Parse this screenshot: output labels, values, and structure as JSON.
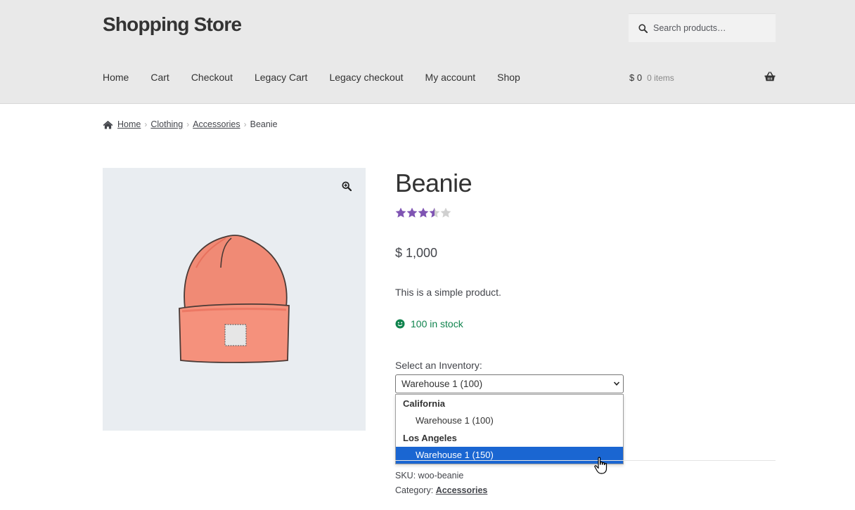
{
  "header": {
    "site_title": "Shopping Store",
    "search_placeholder": "Search products…",
    "nav": [
      "Home",
      "Cart",
      "Checkout",
      "Legacy Cart",
      "Legacy checkout",
      "My account",
      "Shop"
    ],
    "cart_total": "$ 0",
    "cart_items": "0 items"
  },
  "breadcrumb": [
    "Home",
    "Clothing",
    "Accessories",
    "Beanie"
  ],
  "product": {
    "title": "Beanie",
    "rating": 3.5,
    "rating_max": 5,
    "price": "$ 1,000",
    "short_description": "This is a simple product.",
    "stock": "100 in stock",
    "inventory_label": "Select an Inventory:",
    "inventory_selected": "Warehouse 1 (100)",
    "inventory_groups": [
      {
        "label": "California",
        "options": [
          "Warehouse 1 (100)"
        ]
      },
      {
        "label": "Los Angeles",
        "options": [
          "Warehouse 1 (150)"
        ]
      }
    ],
    "highlighted_option": "Warehouse 1 (150)",
    "sku_label": "SKU:",
    "sku": "woo-beanie",
    "category_label": "Category:",
    "category": "Accessories"
  },
  "colors": {
    "header_bg": "#e9e9e9",
    "star": "#7f54b3",
    "stock": "#0f834d",
    "highlight": "#1a66d2",
    "gallery_bg": "#e9edf1"
  }
}
